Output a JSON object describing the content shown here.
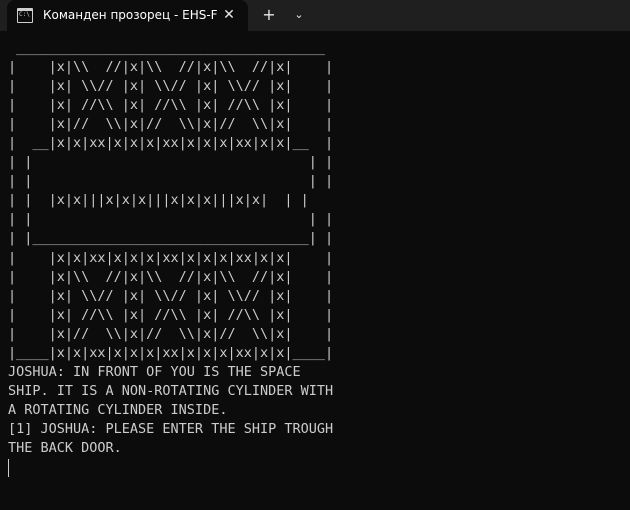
{
  "tab": {
    "icon": "terminal-icon",
    "title": "Команден прозорец - EHS-F",
    "close_glyph": "✕"
  },
  "toolbar": {
    "new_tab_glyph": "+",
    "dropdown_glyph": "⌄"
  },
  "terminal": {
    "lines": [
      " ______________________________________",
      "|    |x|\\\\  //|x|\\\\  //|x|\\\\  //|x|    |",
      "|    |x| \\\\// |x| \\\\// |x| \\\\// |x|    |",
      "|    |x| //\\\\ |x| //\\\\ |x| //\\\\ |x|    |",
      "|    |x|//  \\\\|x|//  \\\\|x|//  \\\\|x|    |",
      "|  __|x|x|xx|x|x|x|xx|x|x|x|xx|x|x|__  |",
      "| |                                  | |",
      "| |                                  | |",
      "| |  |x|x|||x|x|x|||x|x|x|||x|x|  | |",
      "| |                                  | |",
      "| |__________________________________| |",
      "|    |x|x|xx|x|x|x|xx|x|x|x|xx|x|x|    |",
      "|    |x|\\\\  //|x|\\\\  //|x|\\\\  //|x|    |",
      "|    |x| \\\\// |x| \\\\// |x| \\\\// |x|    |",
      "|    |x| //\\\\ |x| //\\\\ |x| //\\\\ |x|    |",
      "|    |x|//  \\\\|x|//  \\\\|x|//  \\\\|x|    |",
      "|____|x|x|xx|x|x|x|xx|x|x|x|xx|x|x|____|",
      "JOSHUA: IN FRONT OF YOU IS THE SPACE",
      "SHIP. IT IS A NON-ROTATING CYLINDER WITH",
      "A ROTATING CYLINDER INSIDE.",
      "[1] JOSHUA: PLEASE ENTER THE SHIP TROUGH",
      "THE BACK DOOR."
    ]
  }
}
